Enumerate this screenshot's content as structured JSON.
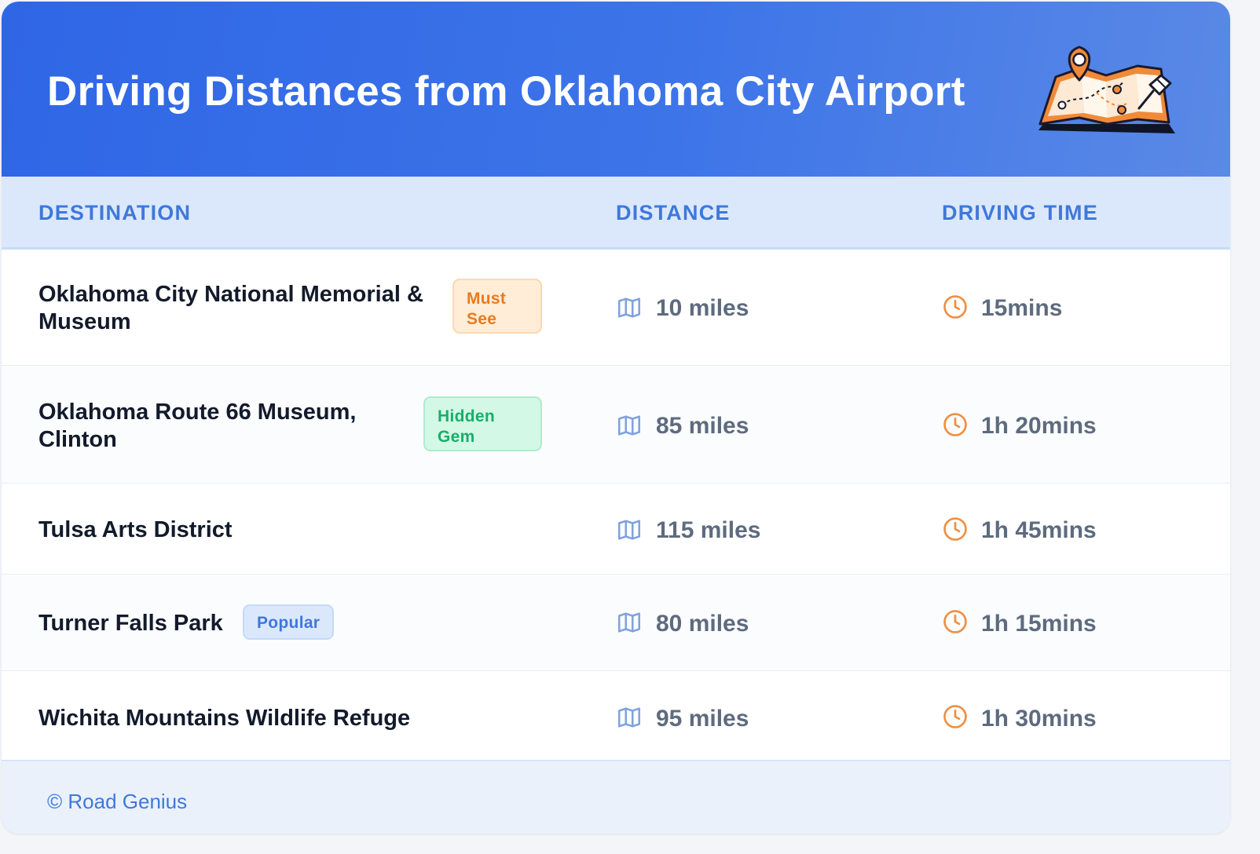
{
  "header": {
    "title": "Driving Distances from Oklahoma City Airport",
    "illustration_icon": "map-with-pins-icon"
  },
  "columns": {
    "destination": "DESTINATION",
    "distance": "DISTANCE",
    "driving_time": "DRIVING TIME"
  },
  "rows": [
    {
      "destination": "Oklahoma City National Memorial & Museum",
      "badge": "Must See",
      "distance": "10 miles",
      "time": "15mins"
    },
    {
      "destination": "Oklahoma Route 66 Museum, Clinton",
      "badge": "Hidden Gem",
      "distance": "85 miles",
      "time": "1h 20mins"
    },
    {
      "destination": "Tulsa Arts District",
      "distance": "115 miles",
      "time": "1h 45mins"
    },
    {
      "destination": "Turner Falls Park",
      "badge": "Popular",
      "distance": "80 miles",
      "time": "1h 15mins"
    },
    {
      "destination": "Wichita Mountains Wildlife Refuge",
      "distance": "95 miles",
      "time": "1h 30mins"
    }
  ],
  "icons": {
    "distance": "map-icon",
    "time": "clock-icon"
  },
  "footer": {
    "credit": "© Road Genius"
  },
  "colors": {
    "header_start": "#2f66e6",
    "header_end": "#5a89e6",
    "accent_blue": "#3f78db",
    "badge_must_see": "#ea7a1d",
    "badge_hidden_gem": "#18ae6b",
    "clock_orange": "#ef8f45"
  }
}
